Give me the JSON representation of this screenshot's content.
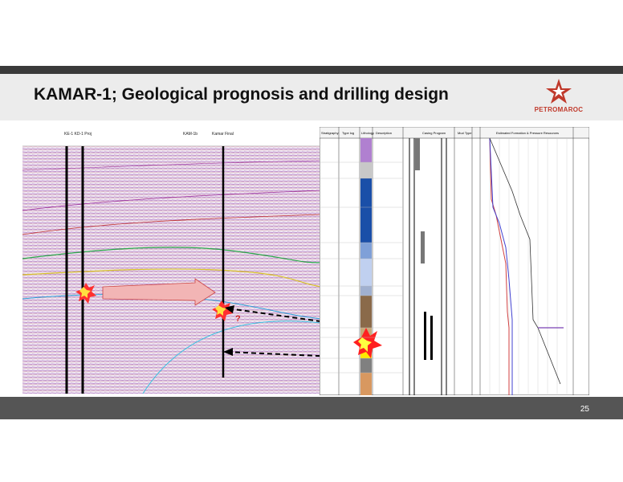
{
  "slide": {
    "title": "KAMAR-1; Geological prognosis and drilling design",
    "page_number": "25"
  },
  "logo": {
    "text": "PETROMAROC"
  },
  "seismic": {
    "well_labels": [
      "KE-1 KD-1 Proj",
      "KAM-1b",
      "Kamar Final"
    ],
    "question_mark": "?"
  },
  "log_panel": {
    "headers": [
      "Stratigraphy",
      "Type log",
      "Lithology",
      "Description",
      "Casing Program",
      "Mud Type",
      "Estimated Formation & Pressure Resources"
    ]
  },
  "colors": {
    "accent_red": "#c0392b",
    "title_band": "#ececec",
    "bar_dark": "#3a3a3a",
    "bar_bottom": "#555555"
  }
}
